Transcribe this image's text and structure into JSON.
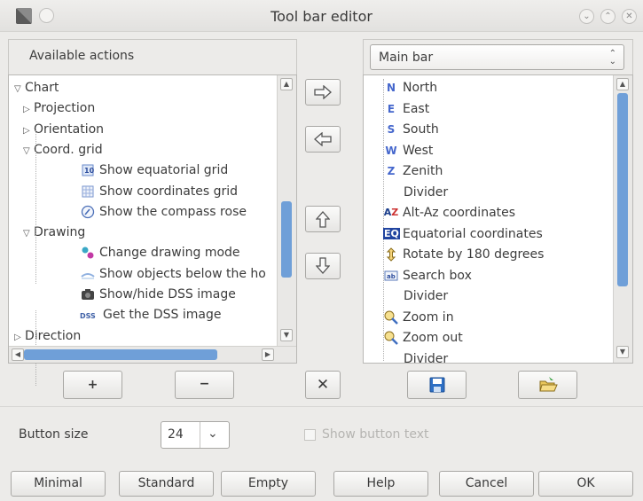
{
  "window": {
    "title": "Tool bar editor"
  },
  "left": {
    "header": "Available actions",
    "tree": [
      {
        "label": "Chart",
        "level": 0,
        "arrow": "▽",
        "icon": ""
      },
      {
        "label": "Projection",
        "level": 1,
        "arrow": "▷",
        "icon": ""
      },
      {
        "label": "Orientation",
        "level": 1,
        "arrow": "▷",
        "icon": ""
      },
      {
        "label": "Coord. grid",
        "level": 1,
        "arrow": "▽",
        "icon": ""
      },
      {
        "label": "Show equatorial grid",
        "level": 2,
        "arrow": "",
        "icon": "equatorial-grid-icon"
      },
      {
        "label": "Show coordinates grid",
        "level": 2,
        "arrow": "",
        "icon": "coordinates-grid-icon"
      },
      {
        "label": "Show the compass rose",
        "level": 2,
        "arrow": "",
        "icon": "compass-icon"
      },
      {
        "label": "Drawing",
        "level": 1,
        "arrow": "▽",
        "icon": ""
      },
      {
        "label": "Change drawing mode",
        "level": 2,
        "arrow": "",
        "icon": "drawing-mode-icon"
      },
      {
        "label": "Show objects below the ho",
        "level": 2,
        "arrow": "",
        "icon": "horizon-icon"
      },
      {
        "label": "Show/hide DSS image",
        "level": 2,
        "arrow": "",
        "icon": "camera-icon"
      },
      {
        "label": "Get the DSS image",
        "level": 2,
        "arrow": "",
        "icon": "dss-icon"
      },
      {
        "label": "Direction",
        "level": 0,
        "arrow": "▷",
        "icon": ""
      }
    ],
    "dss_text": "DSS"
  },
  "right": {
    "bar_select": "Main bar",
    "items": [
      {
        "label": "North",
        "icon": "N",
        "kind": "letter"
      },
      {
        "label": "East",
        "icon": "E",
        "kind": "letter"
      },
      {
        "label": "South",
        "icon": "S",
        "kind": "letter"
      },
      {
        "label": "West",
        "icon": "W",
        "kind": "letter"
      },
      {
        "label": "Zenith",
        "icon": "Z",
        "kind": "letter"
      },
      {
        "label": "Divider",
        "icon": "",
        "kind": "divider"
      },
      {
        "label": "Alt-Az coordinates",
        "icon": "AZ",
        "kind": "altaz"
      },
      {
        "label": "Equatorial coordinates",
        "icon": "EQ",
        "kind": "eq"
      },
      {
        "label": "Rotate by 180 degrees",
        "icon": "",
        "kind": "rotate"
      },
      {
        "label": "Search box",
        "icon": "",
        "kind": "search"
      },
      {
        "label": "Divider",
        "icon": "",
        "kind": "divider"
      },
      {
        "label": "Zoom in",
        "icon": "",
        "kind": "zoomin"
      },
      {
        "label": "Zoom out",
        "icon": "",
        "kind": "zoomout"
      },
      {
        "label": "Divider",
        "icon": "",
        "kind": "divider"
      }
    ]
  },
  "controls": {
    "add": "+",
    "remove": "−",
    "delete": "✕"
  },
  "button_size": {
    "label": "Button size",
    "value": "24",
    "show_text_label": "Show button text"
  },
  "footer": {
    "minimal": "Minimal",
    "standard": "Standard",
    "empty": "Empty",
    "help": "Help",
    "cancel": "Cancel",
    "ok": "OK"
  }
}
